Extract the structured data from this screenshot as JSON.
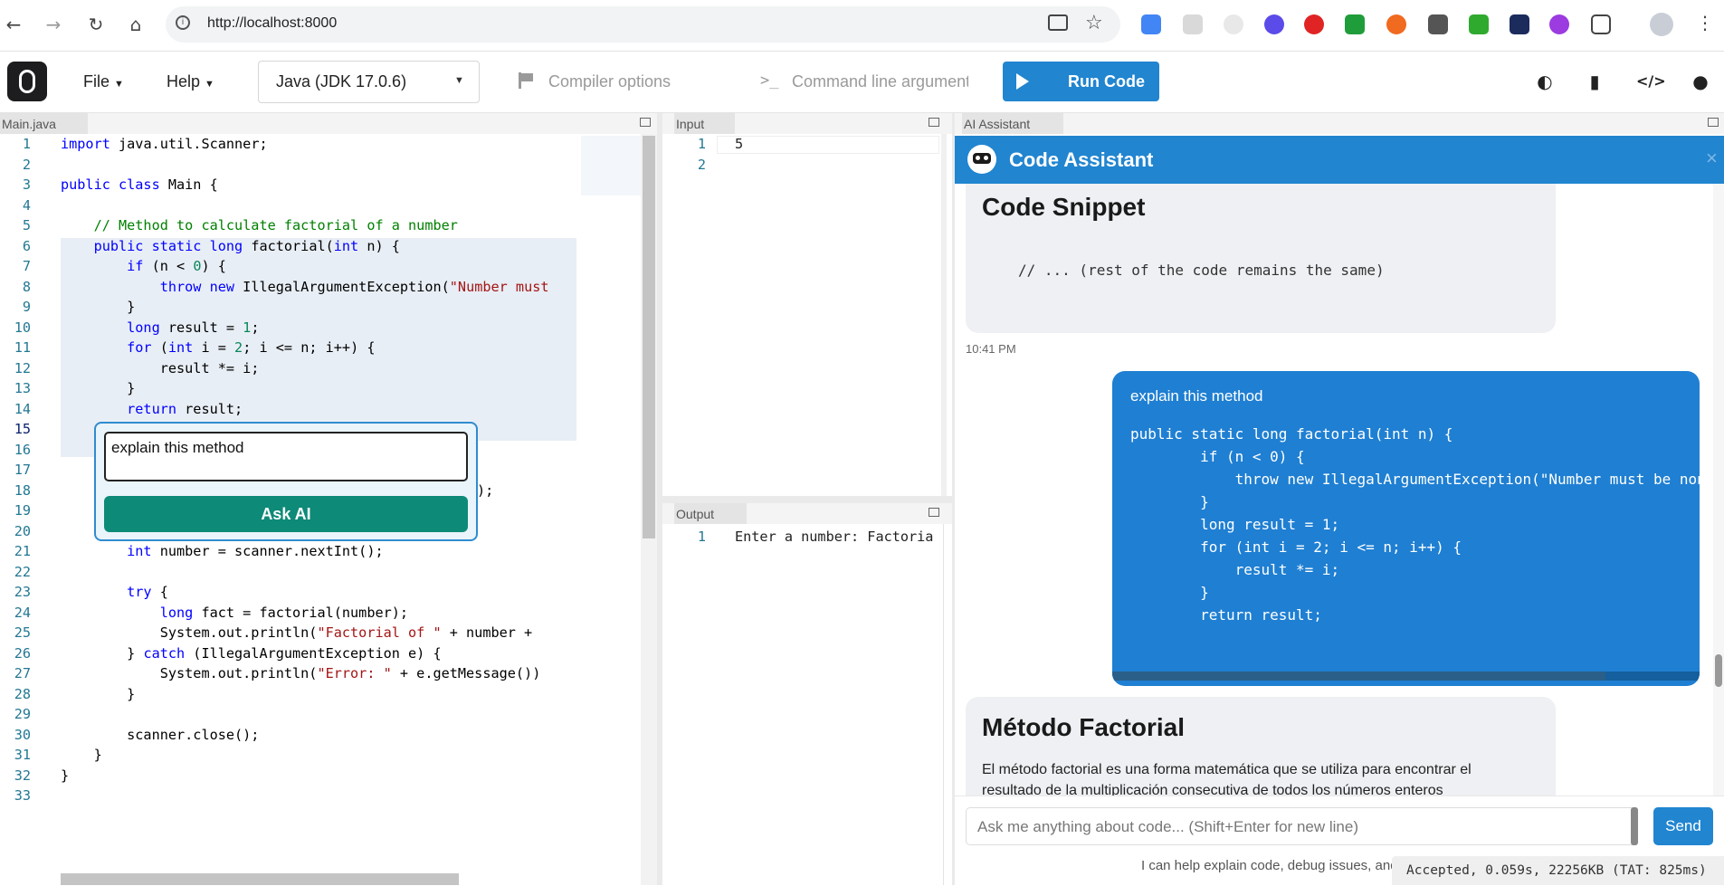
{
  "browser": {
    "url": "http://localhost:8000"
  },
  "toolbar": {
    "file_label": "File",
    "help_label": "Help",
    "language": "Java (JDK 17.0.6)",
    "compiler_options": "Compiler options",
    "command_line_args": "Command line arguments",
    "run_label": "Run Code"
  },
  "editor": {
    "tab_label": "Main.java",
    "line_numbers": [
      "1",
      "2",
      "3",
      "4",
      "5",
      "6",
      "7",
      "8",
      "9",
      "10",
      "11",
      "12",
      "13",
      "14",
      "15",
      "16",
      "17",
      "18",
      "19",
      "20",
      "21",
      "22",
      "23",
      "24",
      "25",
      "26",
      "27",
      "28",
      "29",
      "30",
      "31",
      "32",
      "33"
    ],
    "lines": {
      "l1a": "import",
      "l1b": " java.util.Scanner;",
      "l3a": "public class",
      "l3b": " Main {",
      "l5": "    // Method to calculate factorial of a number",
      "l6a": "    public static long",
      "l6b": " factorial(",
      "l6c": "int",
      "l6d": " n) {",
      "l7a": "        if",
      "l7b": " (n < ",
      "l7c": "0",
      "l7d": ") {",
      "l8a": "            throw new",
      "l8b": " IllegalArgumentException(",
      "l8c": "\"Number must",
      "l9": "        }",
      "l10a": "        long",
      "l10b": " result = ",
      "l10c": "1",
      "l10d": ";",
      "l11a": "        for",
      "l11b": " (",
      "l11c": "int",
      "l11d": " i = ",
      "l11e": "2",
      "l11f": "; i <= n; i++) {",
      "l12": "            result *= i;",
      "l13": "        }",
      "l14a": "        return",
      "l14b": " result;",
      "l18tail": ");",
      "l21a": "        int",
      "l21b": " number = scanner.nextInt();",
      "l23a": "        try",
      "l23b": " {",
      "l24a": "            long",
      "l24b": " fact = factorial(number);",
      "l25a": "            System.out.println(",
      "l25b": "\"Factorial of \"",
      "l25c": " + number +",
      "l26a": "        } ",
      "l26b": "catch",
      "l26c": " (IllegalArgumentException e) {",
      "l27a": "            System.out.println(",
      "l27b": "\"Error: \"",
      "l27c": " + e.getMessage())",
      "l28": "        }",
      "l30": "        scanner.close();",
      "l31": "    }",
      "l32": "}"
    }
  },
  "ask_popup": {
    "input_value": "explain this method",
    "button_label": "Ask AI"
  },
  "input_panel": {
    "tab_label": "Input",
    "line_numbers": [
      "1",
      "2"
    ],
    "value": "5"
  },
  "output_panel": {
    "tab_label": "Output",
    "line_number": "1",
    "text": "Enter a number: Factoria"
  },
  "assistant": {
    "tab_label": "AI Assistant",
    "title": "Code Assistant",
    "msg1_heading": "Code Snippet",
    "msg1_code": "// ... (rest of the code remains the same)",
    "msg1_time": "10:41 PM",
    "user_msg_text": "explain this method",
    "user_code_lines": [
      "public static long factorial(int n) {",
      "        if (n < 0) {",
      "            throw new IllegalArgumentException(\"Number must be non",
      "        }",
      "        long result = 1;",
      "        for (int i = 2; i <= n; i++) {",
      "            result *= i;",
      "        }",
      "        return result;"
    ],
    "reply_heading": "Método Factorial",
    "reply_text_1": "El método factorial es una forma matemática que se utiliza para encontrar el",
    "reply_text_2": "resultado de la multiplicación consecutiva de todos los números enteros",
    "chat_placeholder": "Ask me anything about code... (Shift+Enter for new line)",
    "send_label": "Send",
    "footer_hint": "I can help explain code, debug issues, and"
  },
  "status": {
    "text": "Accepted, 0.059s, 22256KB (TAT: 825ms)"
  },
  "colors": {
    "run_button": "#2185d0",
    "assistant_header": "#2185d0",
    "user_bubble": "#1f7fd2",
    "ask_button": "#0d8a78"
  }
}
